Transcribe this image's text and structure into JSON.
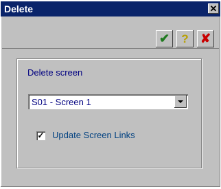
{
  "dialog": {
    "title": "Delete",
    "close_glyph": "✕"
  },
  "toolbar": {
    "ok_glyph": "✔",
    "help_glyph": "?",
    "cancel_glyph": "✘"
  },
  "form": {
    "delete_screen_label": "Delete screen",
    "screen_select_value": "S01 - Screen 1",
    "update_links_label": "Update Screen Links",
    "update_links_checked": true,
    "check_glyph": "✓"
  },
  "colors": {
    "titlebar": "#0a246a",
    "window_bg": "#c0c0c0",
    "label_text": "#000080",
    "ok_icon": "#1f7a1f",
    "help_icon": "#b8a000",
    "cancel_icon": "#c80000"
  }
}
